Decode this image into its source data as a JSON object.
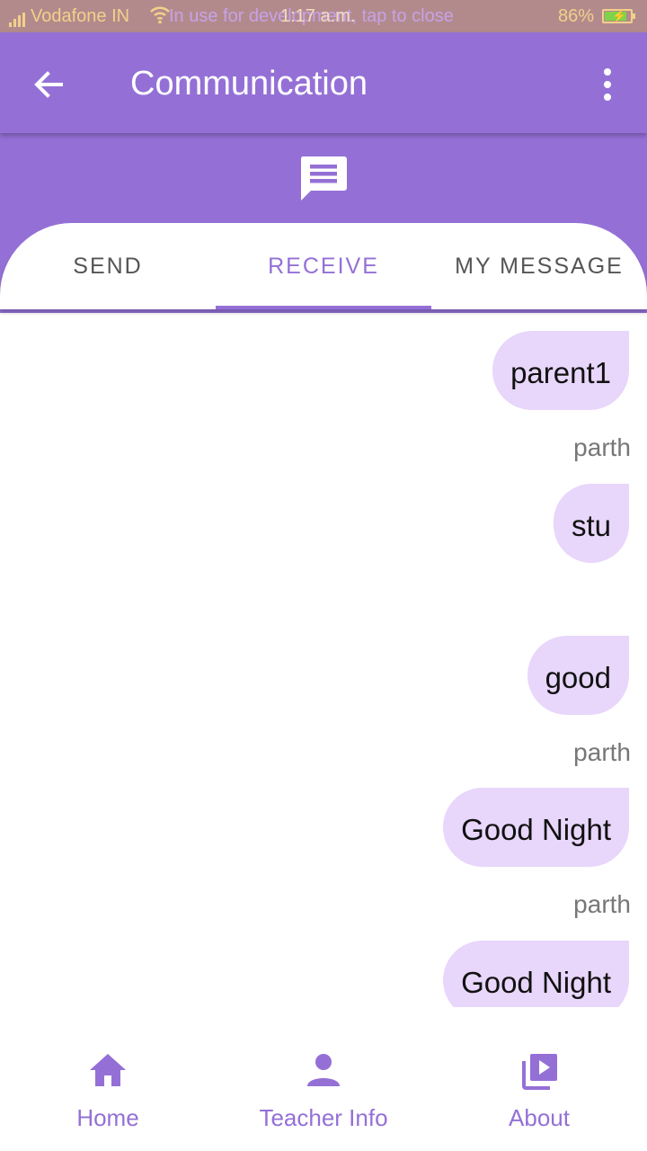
{
  "status_bar": {
    "carrier": "Vodafone IN",
    "dev_notice": "In use for development, tap to close",
    "time": "1:17 a.m.",
    "battery_percent": "86%",
    "battery_level": 0.86
  },
  "app_bar": {
    "title": "Communication",
    "back_icon": "arrow-back-icon",
    "menu_icon": "more-vert-icon"
  },
  "header": {
    "icon": "message-icon"
  },
  "tabs": [
    {
      "label": "SEND",
      "active": false
    },
    {
      "label": "RECEIVE",
      "active": true
    },
    {
      "label": "MY MESSAGE",
      "active": false
    }
  ],
  "messages": [
    {
      "text": "parent1",
      "sender": "parth"
    },
    {
      "text": "stu",
      "sender": ""
    },
    {
      "text": "good",
      "sender": "parth"
    },
    {
      "text": "Good Night",
      "sender": "parth"
    },
    {
      "text": "Good Night",
      "sender": ""
    }
  ],
  "bottom_nav": [
    {
      "label": "Home",
      "icon": "home-icon"
    },
    {
      "label": "Teacher Info",
      "icon": "person-icon"
    },
    {
      "label": "About",
      "icon": "video-library-icon"
    }
  ],
  "colors": {
    "primary": "#9470d6",
    "bubble": "#e8d6fb",
    "status_bar": "#b38a8c"
  }
}
